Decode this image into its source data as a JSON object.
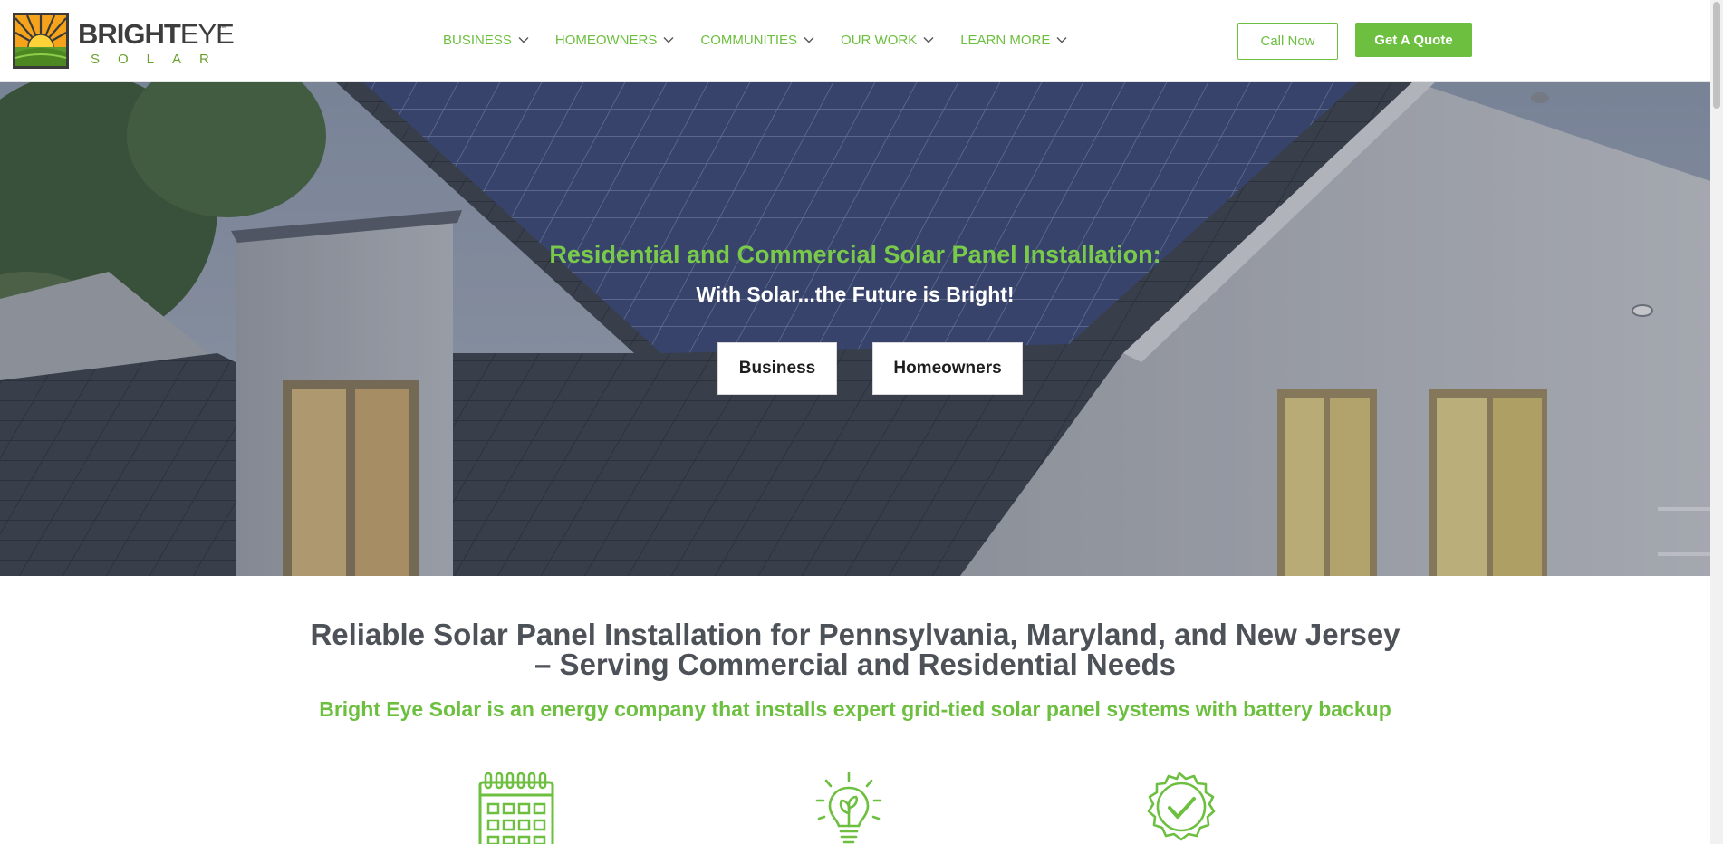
{
  "brand": {
    "name_bold": "BRIGHT",
    "name_thin": "EYE",
    "tm": "™",
    "sub": "SOLAR",
    "logo_icon": "rising-sun-logo-icon"
  },
  "nav": {
    "items": [
      {
        "label": "BUSINESS",
        "icon": "chevron-down-icon"
      },
      {
        "label": "HOMEOWNERS",
        "icon": "chevron-down-icon"
      },
      {
        "label": "COMMUNITIES",
        "icon": "chevron-down-icon"
      },
      {
        "label": "OUR WORK",
        "icon": "chevron-down-icon"
      },
      {
        "label": "LEARN MORE",
        "icon": "chevron-down-icon"
      }
    ]
  },
  "header_buttons": {
    "call": "Call Now",
    "quote": "Get A Quote"
  },
  "hero": {
    "title": "Residential and Commercial Solar Panel Installation:",
    "subtitle": "With Solar...the Future is Bright!",
    "buttons": {
      "business": "Business",
      "homeowners": "Homeowners"
    }
  },
  "intro": {
    "title": "Reliable Solar Panel Installation for Pennsylvania, Maryland, and New Jersey – Serving Commercial and Residential Needs",
    "subtitle": "Bright Eye Solar is an energy company that installs expert grid-tied solar panel systems with battery backup"
  },
  "features": {
    "icons": [
      "calendar-icon",
      "lightbulb-leaf-icon",
      "certified-badge-icon"
    ]
  },
  "colors": {
    "accent": "#6cbf3f",
    "heading": "#4d5158",
    "hero_title": "#79c94b"
  }
}
